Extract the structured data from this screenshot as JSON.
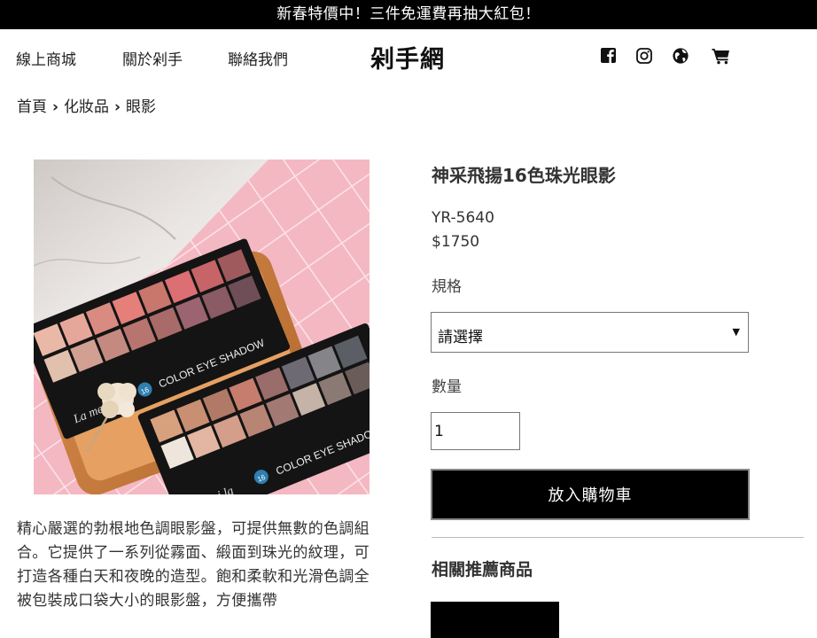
{
  "promo": {
    "text": "新春特價中！三件免運費再抽大紅包！"
  },
  "nav": {
    "links": [
      "線上商城",
      "關於剁手",
      "聯絡我們"
    ],
    "brand": "剁手網",
    "icons": [
      "facebook-icon",
      "instagram-icon",
      "globe-icon",
      "cart-icon"
    ]
  },
  "breadcrumb": {
    "items": [
      "首頁",
      "化妝品",
      "眼影"
    ],
    "separator": "›"
  },
  "image": {
    "palette1_label": "COLOR EYE SHADOW",
    "palette1_logo": "La mei la",
    "palette2_label": "COLOR EYE SHADOW",
    "palette2_logo": "La mei la",
    "badge": "16"
  },
  "description": "精心嚴選的勃根地色調眼影盤，可提供無數的色調組合。它提供了一系列從霧面、緞面到珠光的紋理，可打造各種白天和夜晚的造型。飽和柔軟和光滑色調全被包裝成口袋大小的眼影盤，方便攜帶",
  "product": {
    "title": "神采飛揚16色珠光眼影",
    "sku": "YR-5640",
    "price": "$1750",
    "spec_label": "規格",
    "spec_selected": "請選擇",
    "qty_label": "數量",
    "qty_value": "1",
    "add_to_cart": "放入購物車"
  },
  "related": {
    "title": "相關推薦商品"
  },
  "colors": {
    "promo_bg": "#000000",
    "button_bg": "#000000",
    "button_text": "#ffffff"
  }
}
